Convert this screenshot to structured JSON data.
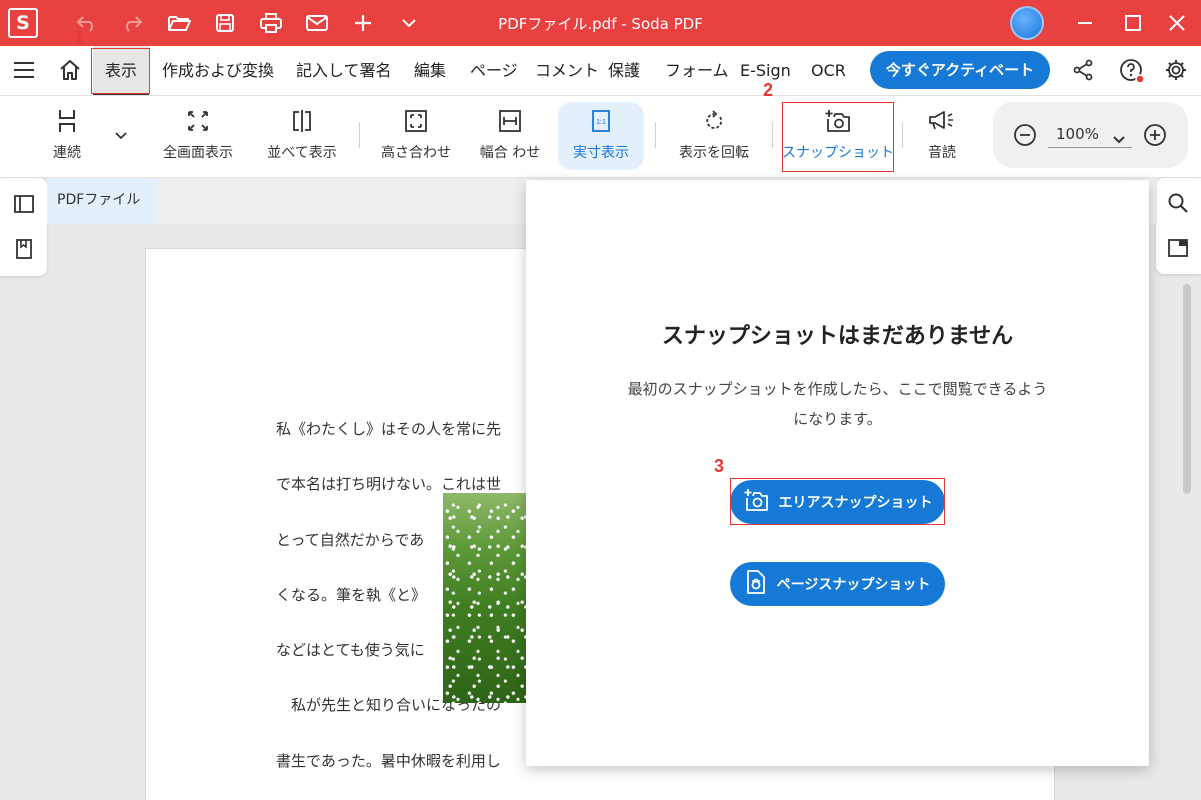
{
  "window": {
    "logo": "S",
    "title": "PDFファイル.pdf  -  Soda PDF"
  },
  "menu": {
    "items": [
      "表示",
      "作成および変換",
      "記入して署名",
      "編集",
      "ページ",
      "コメント",
      "保護",
      "フォーム",
      "E-Sign",
      "OCR"
    ],
    "cta_label": "今すぐアクティベート"
  },
  "toolbar": {
    "tools": [
      "連続",
      "全画面表示",
      "並べて表示",
      "高さ合わせ",
      "幅合 わせ",
      "実寸表示",
      "表示を回転",
      "スナップショット",
      "音読"
    ],
    "zoom_value": "100%"
  },
  "annotations": {
    "step1": "1",
    "step2": "2",
    "step3": "3"
  },
  "document": {
    "tab_label": "PDFファイル",
    "lines": [
      "私《わたくし》はその人を常に先",
      "で本名は打ち明けない。これは世",
      "とって自然だからであ",
      "くなる。筆を執《と》",
      "などはとても使う気に",
      "　私が先生と知り合いになったの",
      "書生であった。暑中休暇を利用し"
    ]
  },
  "snapshot_panel": {
    "title": "スナップショットはまだありません",
    "description": "最初のスナップショットを作成したら、ここで閲覧できるようになります。",
    "area_button": "エリアスナップショット",
    "page_button": "ページスナップショット"
  },
  "colors": {
    "titlebar": "#e8413f",
    "accent": "#1779d6",
    "annotation": "#e53935"
  }
}
